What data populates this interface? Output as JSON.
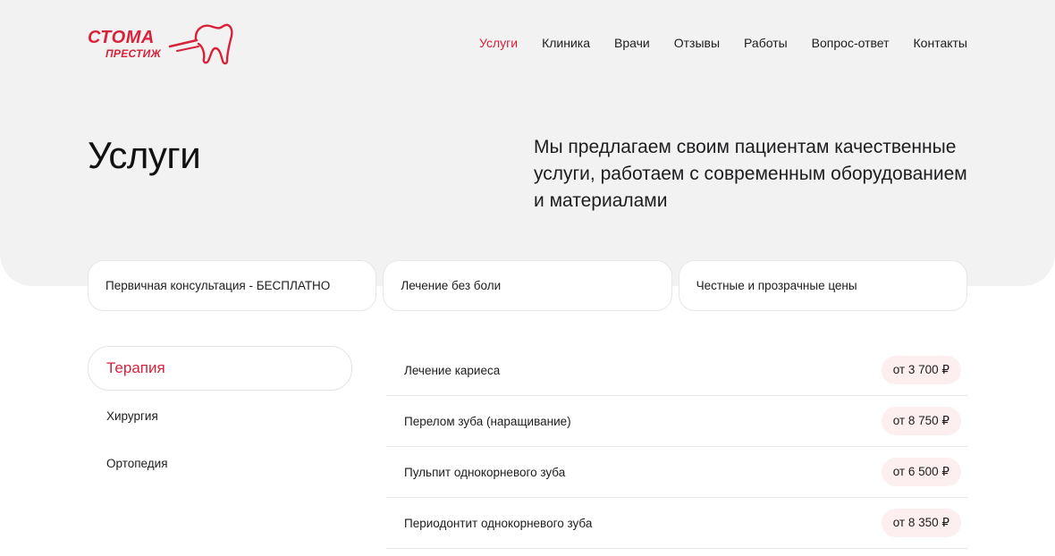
{
  "brand": {
    "logo_top": "СТОМА",
    "logo_bottom": "ПРЕСТИЖ",
    "accent": "#d8223a"
  },
  "nav": {
    "items": [
      {
        "label": "Услуги",
        "active": true
      },
      {
        "label": "Клиника",
        "active": false
      },
      {
        "label": "Врачи",
        "active": false
      },
      {
        "label": "Отзывы",
        "active": false
      },
      {
        "label": "Работы",
        "active": false
      },
      {
        "label": "Вопрос-ответ",
        "active": false
      },
      {
        "label": "Контакты",
        "active": false
      }
    ]
  },
  "hero": {
    "title": "Услуги",
    "description": "Мы предлагаем своим пациентам качественные услуги, работаем с современным оборудованием и материалами"
  },
  "features": [
    {
      "label": "Первичная консультация - БЕСПЛАТНО"
    },
    {
      "label": "Лечение без боли"
    },
    {
      "label": "Честные и прозрачные цены"
    }
  ],
  "categories": [
    {
      "label": "Терапия",
      "active": true
    },
    {
      "label": "Хирургия",
      "active": false
    },
    {
      "label": "Ортопедия",
      "active": false
    }
  ],
  "services": [
    {
      "name": "Лечение кариеса",
      "price": "от 3 700 ₽"
    },
    {
      "name": "Перелом зуба (наращивание)",
      "price": "от 8 750 ₽"
    },
    {
      "name": "Пульпит однокорневого зуба",
      "price": "от 6 500 ₽"
    },
    {
      "name": "Периодонтит однокорневого зуба",
      "price": "от 8 350 ₽"
    }
  ]
}
